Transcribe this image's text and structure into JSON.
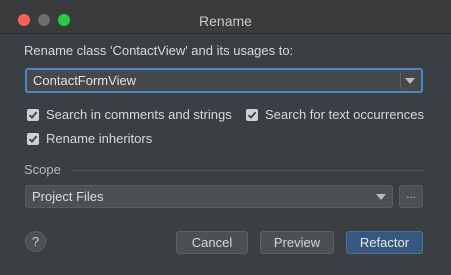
{
  "window": {
    "title": "Rename"
  },
  "form": {
    "prompt": "Rename class 'ContactView' and its usages to:",
    "new_name": "ContactFormView"
  },
  "options": {
    "search_comments": {
      "label": "Search in comments and strings",
      "checked": true
    },
    "search_text": {
      "label": "Search for text occurrences",
      "checked": true
    },
    "rename_inheritors": {
      "label": "Rename inheritors",
      "checked": true
    }
  },
  "scope": {
    "label": "Scope",
    "selected": "Project Files",
    "more_label": "..."
  },
  "buttons": {
    "help": "?",
    "cancel": "Cancel",
    "preview": "Preview",
    "refactor": "Refactor"
  }
}
